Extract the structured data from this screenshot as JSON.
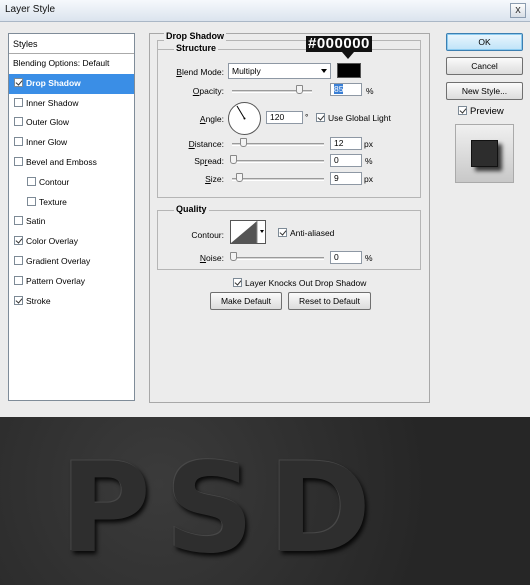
{
  "window": {
    "title": "Layer Style",
    "close_label": "x"
  },
  "styles_panel": {
    "header": "Styles",
    "items": [
      {
        "label": "Blending Options: Default",
        "checkbox": null,
        "checked": false,
        "selected": false,
        "indent": 0
      },
      {
        "label": "Drop Shadow",
        "checkbox": true,
        "checked": true,
        "selected": true,
        "indent": 0
      },
      {
        "label": "Inner Shadow",
        "checkbox": true,
        "checked": false,
        "selected": false,
        "indent": 0
      },
      {
        "label": "Outer Glow",
        "checkbox": true,
        "checked": false,
        "selected": false,
        "indent": 0
      },
      {
        "label": "Inner Glow",
        "checkbox": true,
        "checked": false,
        "selected": false,
        "indent": 0
      },
      {
        "label": "Bevel and Emboss",
        "checkbox": true,
        "checked": false,
        "selected": false,
        "indent": 0
      },
      {
        "label": "Contour",
        "checkbox": true,
        "checked": false,
        "selected": false,
        "indent": 1
      },
      {
        "label": "Texture",
        "checkbox": true,
        "checked": false,
        "selected": false,
        "indent": 1
      },
      {
        "label": "Satin",
        "checkbox": true,
        "checked": false,
        "selected": false,
        "indent": 0
      },
      {
        "label": "Color Overlay",
        "checkbox": true,
        "checked": true,
        "selected": false,
        "indent": 0
      },
      {
        "label": "Gradient Overlay",
        "checkbox": true,
        "checked": false,
        "selected": false,
        "indent": 0
      },
      {
        "label": "Pattern Overlay",
        "checkbox": true,
        "checked": false,
        "selected": false,
        "indent": 0
      },
      {
        "label": "Stroke",
        "checkbox": true,
        "checked": true,
        "selected": false,
        "indent": 0
      }
    ]
  },
  "drop_shadow": {
    "title": "Drop Shadow",
    "structure": {
      "title": "Structure",
      "blend_mode_label": "Blend Mode:",
      "blend_mode_value": "Multiply",
      "color_annotation": "#000000",
      "color": "#000000",
      "opacity_label": "Opacity:",
      "opacity_value": "85",
      "opacity_unit": "%",
      "opacity_level": 0.85,
      "angle_label": "Angle:",
      "angle_value": "120",
      "angle_unit": "°",
      "use_global_light_label": "Use Global Light",
      "use_global_light": true,
      "distance_label": "Distance:",
      "distance_value": "12",
      "distance_unit": "px",
      "spread_label": "Spread:",
      "spread_value": "0",
      "spread_unit": "%",
      "size_label": "Size:",
      "size_value": "9",
      "size_unit": "px"
    },
    "quality": {
      "title": "Quality",
      "contour_label": "Contour:",
      "anti_aliased_label": "Anti-aliased",
      "anti_aliased": true,
      "noise_label": "Noise:",
      "noise_value": "0",
      "noise_unit": "%"
    },
    "knocks_out_label": "Layer Knocks Out Drop Shadow",
    "knocks_out": true,
    "make_default_label": "Make Default",
    "reset_default_label": "Reset to Default"
  },
  "actions": {
    "ok_label": "OK",
    "cancel_label": "Cancel",
    "new_style_label": "New Style...",
    "preview_label": "Preview",
    "preview_checked": true
  },
  "canvas": {
    "text": "PSD"
  },
  "colors": {
    "selection": "#3a8ee6",
    "dialog_bg": "#ececec",
    "canvas_bg": "#2b2b2b"
  }
}
